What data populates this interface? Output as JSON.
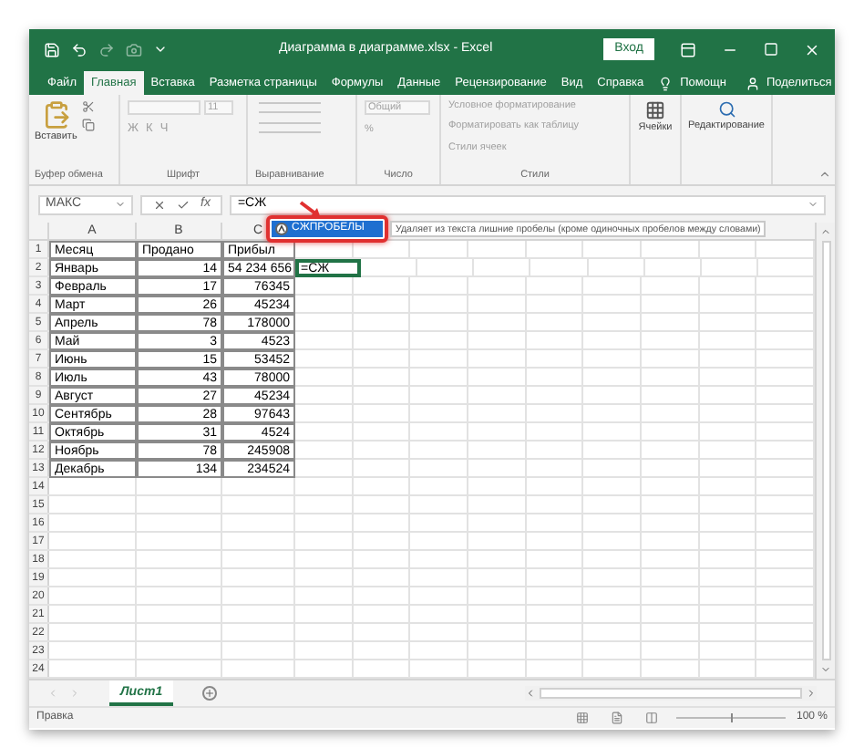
{
  "window": {
    "title": "Диаграмма в диаграмме.xlsx - Excel",
    "signin": "Вход"
  },
  "menu": [
    {
      "label": "Файл",
      "selected": false
    },
    {
      "label": "Главная",
      "selected": true
    },
    {
      "label": "Вставка",
      "selected": false
    },
    {
      "label": "Разметка страницы",
      "selected": false
    },
    {
      "label": "Формулы",
      "selected": false
    },
    {
      "label": "Данные",
      "selected": false
    },
    {
      "label": "Рецензирование",
      "selected": false
    },
    {
      "label": "Вид",
      "selected": false
    },
    {
      "label": "Справка",
      "selected": false
    }
  ],
  "help": "Помощн",
  "share": "Поделиться",
  "ribbon": {
    "paste": "Вставить",
    "font_size": "11",
    "font_buttons": [
      "Ж",
      "К",
      "Ч"
    ],
    "number_format": "Общий",
    "percent": "%",
    "styles": [
      "Условное форматирование",
      "Форматировать как таблицу",
      "Стили ячеек"
    ],
    "cells": "Ячейки",
    "editing": "Редактирование",
    "groups": [
      "Буфер обмена",
      "Шрифт",
      "Выравнивание",
      "Число",
      "Стили"
    ]
  },
  "formula_bar": {
    "name_box": "МАКС",
    "function_symbol": "fx",
    "formula": "=СЖ"
  },
  "autocomplete": {
    "items": [
      {
        "label": "СЖПРОБЕЛЫ",
        "selected": true
      }
    ],
    "tooltip": "Удаляет из текста лишние пробелы (кроме одиночных пробелов между словами)"
  },
  "sheet": {
    "columns": [
      "A",
      "B",
      "C"
    ],
    "rows": [
      {
        "number": "1",
        "cells": [
          "Месяц",
          "Продано",
          "Прибыл"
        ]
      },
      {
        "number": "2",
        "cells": [
          "Январь",
          "14",
          "54 234 656",
          "=СЖ"
        ]
      },
      {
        "number": "3",
        "cells": [
          "Февраль",
          "17",
          "76345"
        ]
      },
      {
        "number": "4",
        "cells": [
          "Март",
          "26",
          "45234"
        ]
      },
      {
        "number": "5",
        "cells": [
          "Апрель",
          "78",
          "178000"
        ]
      },
      {
        "number": "6",
        "cells": [
          "Май",
          "3",
          "4523"
        ]
      },
      {
        "number": "7",
        "cells": [
          "Июнь",
          "15",
          "53452"
        ]
      },
      {
        "number": "8",
        "cells": [
          "Июль",
          "43",
          "78000"
        ]
      },
      {
        "number": "9",
        "cells": [
          "Август",
          "27",
          "45234"
        ]
      },
      {
        "number": "10",
        "cells": [
          "Сентябрь",
          "28",
          "97643"
        ]
      },
      {
        "number": "11",
        "cells": [
          "Октябрь",
          "31",
          "4524"
        ]
      },
      {
        "number": "12",
        "cells": [
          "Ноябрь",
          "78",
          "245908"
        ]
      },
      {
        "number": "13",
        "cells": [
          "Декабрь",
          "134",
          "234524"
        ]
      },
      {
        "number": "14"
      },
      {
        "number": "15"
      },
      {
        "number": "16"
      },
      {
        "number": "17"
      },
      {
        "number": "18"
      },
      {
        "number": "19"
      },
      {
        "number": "20"
      },
      {
        "number": "21"
      },
      {
        "number": "22"
      },
      {
        "number": "23"
      },
      {
        "number": "24"
      }
    ]
  },
  "sheet_tabs": [
    {
      "label": "Лист1",
      "selected": true
    }
  ],
  "status_bar": {
    "mode": "Правка",
    "zoom": "100 %",
    "level": 0.5
  }
}
